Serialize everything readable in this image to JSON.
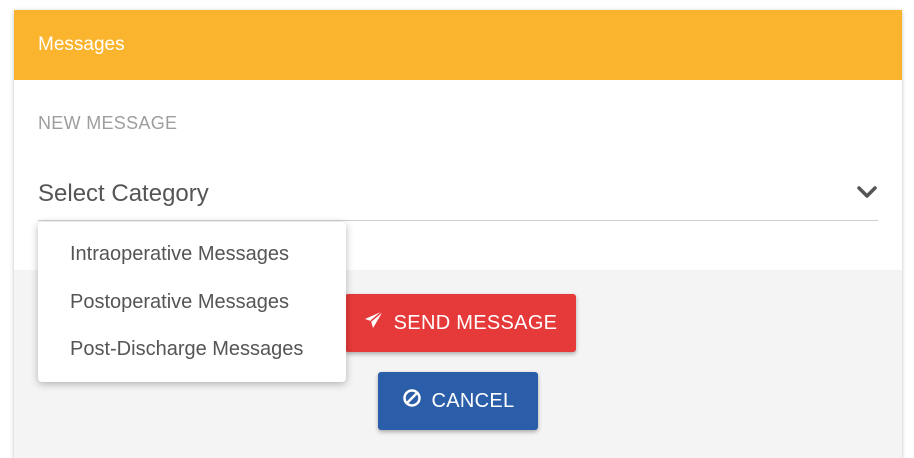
{
  "header": {
    "title": "Messages"
  },
  "form": {
    "section_label": "NEW MESSAGE",
    "category_select": {
      "selected": "Select Category",
      "icon": "chevron-down-icon"
    }
  },
  "dropdown": {
    "options": [
      "Intraoperative Messages",
      "Postoperative Messages",
      "Post-Discharge Messages"
    ]
  },
  "buttons": {
    "send": {
      "label": "SEND MESSAGE",
      "icon": "paper-plane-icon"
    },
    "cancel": {
      "label": "CANCEL",
      "icon": "ban-icon"
    }
  },
  "colors": {
    "header_bg": "#fbb42e",
    "send_bg": "#e63a3a",
    "cancel_bg": "#2b5ea8",
    "panel_bg": "#f4f4f4"
  }
}
